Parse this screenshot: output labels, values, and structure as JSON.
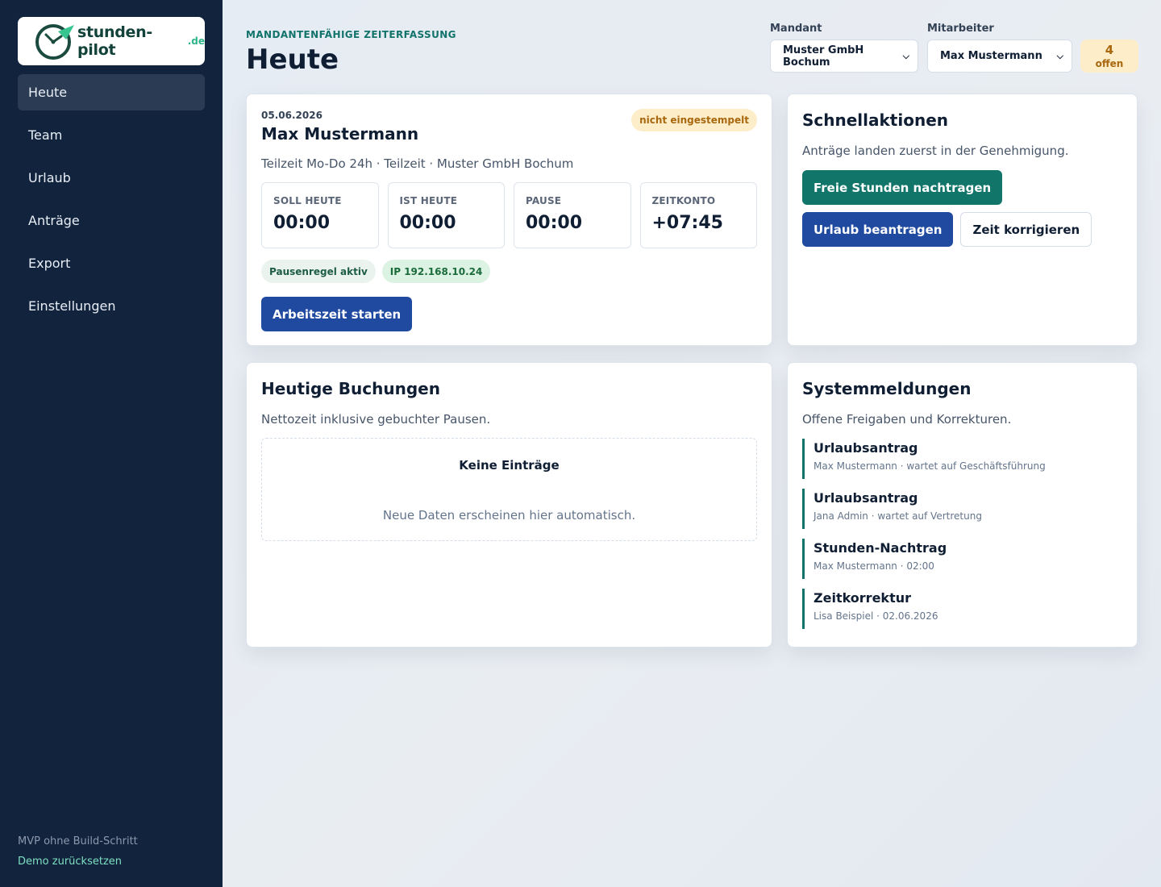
{
  "app": {
    "logo_text": "stunden-pilot",
    "logo_tld": ".de"
  },
  "nav": [
    "Heute",
    "Team",
    "Urlaub",
    "Anträge",
    "Export",
    "Einstellungen"
  ],
  "sidebar_footer": {
    "note": "MVP ohne Build-Schritt",
    "reset_link": "Demo zurücksetzen"
  },
  "header": {
    "eyebrow": "MANDANTENFÄHIGE ZEITERFASSUNG",
    "title": "Heute",
    "tenant_label": "Mandant",
    "tenant_value": "Muster GmbH Bochum",
    "employee_label": "Mitarbeiter",
    "employee_value": "Max Mustermann",
    "open_count": "4",
    "open_label": "offen"
  },
  "today": {
    "date": "05.06.2026",
    "name": "Max Mustermann",
    "status": "nicht eingestempelt",
    "details": "Teilzeit Mo-Do 24h · Teilzeit · Muster GmbH Bochum",
    "stats": [
      {
        "label": "SOLL HEUTE",
        "value": "00:00"
      },
      {
        "label": "IST HEUTE",
        "value": "00:00"
      },
      {
        "label": "PAUSE",
        "value": "00:00"
      },
      {
        "label": "ZEITKONTO",
        "value": "+07:45"
      }
    ],
    "tag_break": "Pausenregel aktiv",
    "tag_ip": "IP 192.168.10.24",
    "start_button": "Arbeitszeit starten"
  },
  "quick": {
    "title": "Schnellaktionen",
    "subtitle": "Anträge landen zuerst in der Genehmigung.",
    "btn_hours": "Freie Stunden nachtragen",
    "btn_vacation": "Urlaub beantragen",
    "btn_correct": "Zeit korrigieren"
  },
  "bookings": {
    "title": "Heutige Buchungen",
    "subtitle": "Nettozeit inklusive gebuchter Pausen.",
    "empty_title": "Keine Einträge",
    "empty_sub": "Neue Daten erscheinen hier automatisch."
  },
  "messages": {
    "title": "Systemmeldungen",
    "subtitle": "Offene Freigaben und Korrekturen.",
    "items": [
      {
        "title": "Urlaubsantrag",
        "sub": "Max Mustermann · wartet auf Geschäftsführung"
      },
      {
        "title": "Urlaubsantrag",
        "sub": "Jana Admin · wartet auf Vertretung"
      },
      {
        "title": "Stunden-Nachtrag",
        "sub": "Max Mustermann · 02:00"
      },
      {
        "title": "Zeitkorrektur",
        "sub": "Lisa Beispiel · 02.06.2026"
      }
    ]
  }
}
